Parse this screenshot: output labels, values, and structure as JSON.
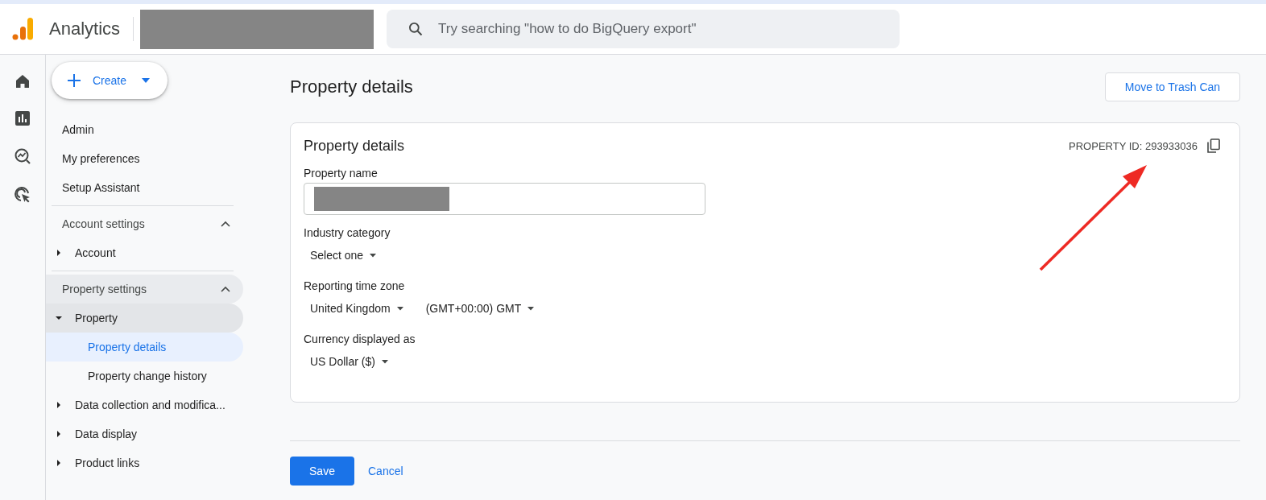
{
  "header": {
    "product": "Analytics",
    "search": {
      "placeholder": "Try searching \"how to do BigQuery export\""
    }
  },
  "sidebar": {
    "create_button": "Create",
    "links": [
      {
        "label": "Admin",
        "selected": false
      },
      {
        "label": "My preferences",
        "selected": false
      },
      {
        "label": "Setup Assistant",
        "selected": false
      }
    ],
    "sections": [
      {
        "title": "Account settings",
        "expanded": true,
        "highlighted": false,
        "items": [
          {
            "label": "Account",
            "expanded": false,
            "highlighted": false
          }
        ]
      },
      {
        "title": "Property settings",
        "expanded": true,
        "highlighted": true,
        "items": [
          {
            "label": "Property",
            "expanded": true,
            "highlighted": true,
            "children": [
              {
                "label": "Property details",
                "selected": true
              },
              {
                "label": "Property change history",
                "selected": false
              }
            ]
          },
          {
            "label": "Data collection and modifica...",
            "expanded": false,
            "highlighted": false
          },
          {
            "label": "Data display",
            "expanded": false,
            "highlighted": false
          },
          {
            "label": "Product links",
            "expanded": false,
            "highlighted": false
          }
        ]
      }
    ]
  },
  "page": {
    "title": "Property details",
    "trash_button": "Move to Trash Can",
    "card": {
      "title": "Property details",
      "property_id": "PROPERTY ID: 293933036",
      "fields": [
        {
          "kind": "text",
          "label": "Property name"
        },
        {
          "kind": "select",
          "label": "Industry category",
          "options": [
            "Select one"
          ]
        },
        {
          "kind": "select",
          "label": "Reporting time zone",
          "options": [
            "United Kingdom",
            "(GMT+00:00) GMT"
          ]
        },
        {
          "kind": "select",
          "label": "Currency displayed as",
          "options": [
            "US Dollar ($)"
          ]
        }
      ]
    },
    "save_button": "Save",
    "cancel_link": "Cancel"
  }
}
